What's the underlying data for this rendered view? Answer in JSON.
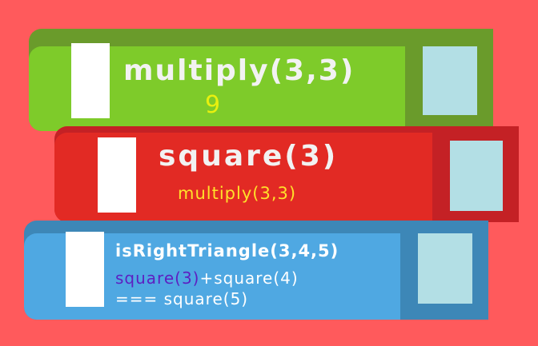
{
  "colors": {
    "background": "#ff5a5c",
    "green_book": "#7ecb2a",
    "red_book": "#e22a24",
    "blue_book": "#4fa8e2",
    "pages": "#b3dfe5",
    "result_yellow": "#e8f00f",
    "call_yellow": "#ffe12a",
    "highlight_purple": "#5d1fc1"
  },
  "books": {
    "top": {
      "title": "multiply(3,3)",
      "value": "9"
    },
    "middle": {
      "title": "square(3)",
      "call": "multiply(3,3)"
    },
    "bottom": {
      "title": "isRightTriangle(3,4,5)",
      "line2_highlight": "square(3)",
      "line2_rest": "+square(4)",
      "line3": "=== square(5)"
    }
  }
}
